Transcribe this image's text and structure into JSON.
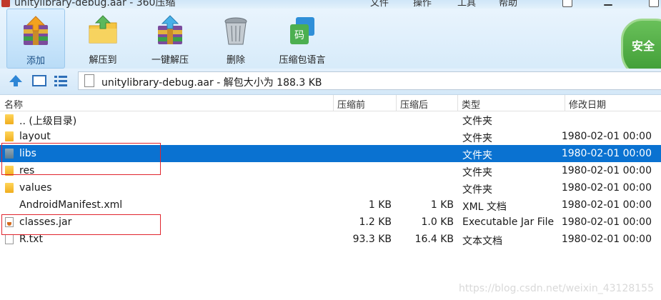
{
  "window": {
    "title": "unitylibrary-debug.aar - 360压缩",
    "menu": [
      "文件",
      "操作",
      "工具",
      "帮助"
    ]
  },
  "toolbar": {
    "add_label": "添加",
    "extract_to_label": "解压到",
    "one_click_extract_label": "一键解压",
    "delete_label": "删除",
    "language_label": "压缩包语言",
    "language_icon_text": "码",
    "security_label": "安全"
  },
  "address": {
    "path": "unitylibrary-debug.aar - 解包大小为 188.3 KB"
  },
  "columns": {
    "name": "名称",
    "before": "压缩前",
    "after": "压缩后",
    "type": "类型",
    "modified": "修改日期"
  },
  "files": [
    {
      "name": ".. (上级目录)",
      "before": "",
      "after": "",
      "type": "文件夹",
      "modified": "",
      "icon": "folder-icon"
    },
    {
      "name": "layout",
      "before": "",
      "after": "",
      "type": "文件夹",
      "modified": "1980-02-01 00:00",
      "icon": "folder-icon"
    },
    {
      "name": "libs",
      "before": "",
      "after": "",
      "type": "文件夹",
      "modified": "1980-02-01 00:00",
      "icon": "folder-icon"
    },
    {
      "name": "res",
      "before": "",
      "after": "",
      "type": "文件夹",
      "modified": "1980-02-01 00:00",
      "icon": "folder-icon"
    },
    {
      "name": "values",
      "before": "",
      "after": "",
      "type": "文件夹",
      "modified": "1980-02-01 00:00",
      "icon": "folder-icon"
    },
    {
      "name": "AndroidManifest.xml",
      "before": "1 KB",
      "after": "1 KB",
      "type": "XML 文档",
      "modified": "1980-02-01 00:00",
      "icon": "xml-file-icon"
    },
    {
      "name": "classes.jar",
      "before": "1.2 KB",
      "after": "1.0 KB",
      "type": "Executable Jar File",
      "modified": "1980-02-01 00:00",
      "icon": "jar-file-icon"
    },
    {
      "name": "R.txt",
      "before": "93.3 KB",
      "after": "16.4 KB",
      "type": "文本文档",
      "modified": "1980-02-01 00:00",
      "icon": "text-file-icon"
    }
  ],
  "watermark": "https://blog.csdn.net/weixin_43128155",
  "colors": {
    "selection": "#0a72d1",
    "highlight_box": "#e0242d",
    "toolbar_bg": "#d7ebfa"
  }
}
